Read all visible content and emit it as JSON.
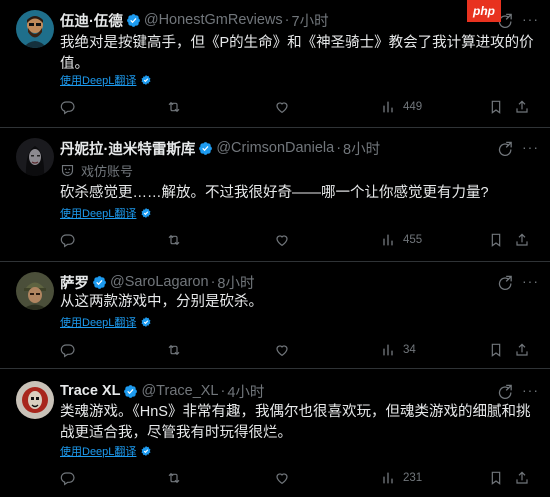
{
  "watermark": "php",
  "translate_label": "使用DeepL翻译",
  "colors": {
    "accent": "#1d9bf0",
    "muted": "#71767b",
    "text": "#e7e9ea",
    "divider": "#2f3336",
    "bg": "#000000"
  },
  "tweets": [
    {
      "name": "伍迪·伍德",
      "handle": "@HonestGmReviews",
      "dot": "·",
      "time": "7小时",
      "text": "我绝对是按键高手，但《P的生命》和《神圣骑士》教会了我计算进攻的价值。",
      "views": "449"
    },
    {
      "name": "丹妮拉·迪米特雷斯库",
      "handle": "@CrimsonDaniela",
      "dot": "·",
      "time": "8小时",
      "sub": "戏仿账号",
      "text": "砍杀感觉更……解放。不过我很好奇——哪一个让你感觉更有力量?",
      "views": "455"
    },
    {
      "name": "萨罗",
      "handle": "@SaroLagaron",
      "dot": "·",
      "time": "8小时",
      "text": "从这两款游戏中，分别是砍杀。",
      "views": "34"
    },
    {
      "name": "Trace XL",
      "handle": "@Trace_XL",
      "dot": "·",
      "time": "4小时",
      "text": "类魂游戏。《HnS》非常有趣，我偶尔也很喜欢玩，但魂类游戏的细腻和挑战更适合我，尽管我有时玩得很烂。",
      "views": "231"
    }
  ]
}
